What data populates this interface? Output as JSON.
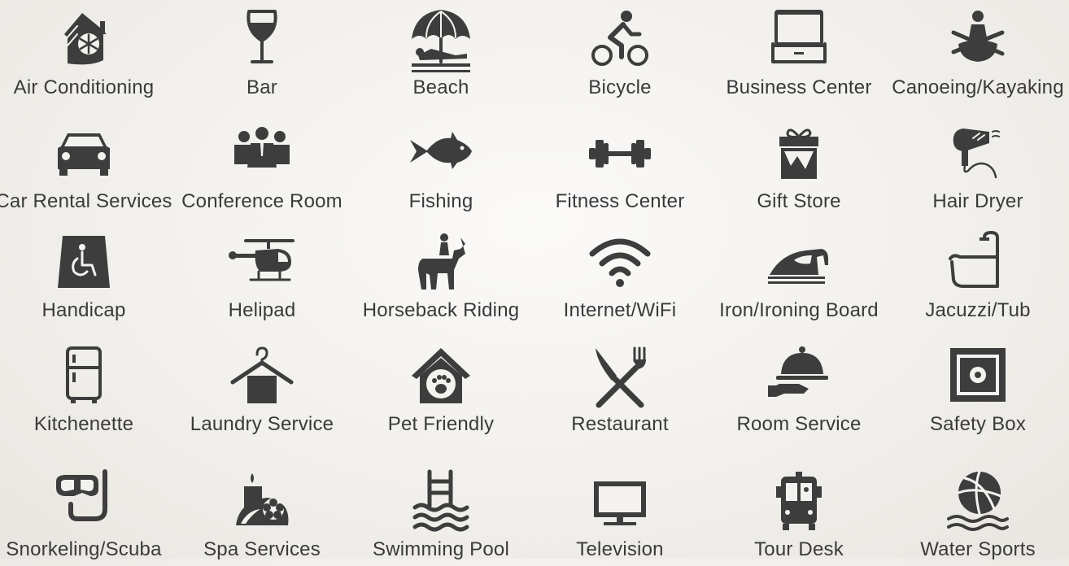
{
  "amenities": [
    {
      "label": "Air Conditioning",
      "icon": "air-conditioning-icon"
    },
    {
      "label": "Bar",
      "icon": "wine-glass-icon"
    },
    {
      "label": "Beach",
      "icon": "beach-umbrella-icon"
    },
    {
      "label": "Bicycle",
      "icon": "bicycle-icon"
    },
    {
      "label": "Business Center",
      "icon": "laptop-icon"
    },
    {
      "label": "Canoeing/Kayaking",
      "icon": "kayak-icon"
    },
    {
      "label": "Car Rental Services",
      "icon": "car-icon"
    },
    {
      "label": "Conference Room",
      "icon": "conference-people-icon"
    },
    {
      "label": "Fishing",
      "icon": "fish-icon"
    },
    {
      "label": "Fitness Center",
      "icon": "dumbbell-icon"
    },
    {
      "label": "Gift Store",
      "icon": "gift-icon"
    },
    {
      "label": "Hair Dryer",
      "icon": "hair-dryer-icon"
    },
    {
      "label": "Handicap",
      "icon": "wheelchair-icon"
    },
    {
      "label": "Helipad",
      "icon": "helicopter-icon"
    },
    {
      "label": "Horseback Riding",
      "icon": "horse-rider-icon"
    },
    {
      "label": "Internet/WiFi",
      "icon": "wifi-icon"
    },
    {
      "label": "Iron/Ironing Board",
      "icon": "iron-icon"
    },
    {
      "label": "Jacuzzi/Tub",
      "icon": "bathtub-icon"
    },
    {
      "label": "Kitchenette",
      "icon": "refrigerator-icon"
    },
    {
      "label": "Laundry Service",
      "icon": "hanger-icon"
    },
    {
      "label": "Pet Friendly",
      "icon": "pet-house-icon"
    },
    {
      "label": "Restaurant",
      "icon": "knife-fork-icon"
    },
    {
      "label": "Room Service",
      "icon": "cloche-icon"
    },
    {
      "label": "Safety Box",
      "icon": "safe-icon"
    },
    {
      "label": "Snorkeling/Scuba",
      "icon": "snorkel-mask-icon"
    },
    {
      "label": "Spa Services",
      "icon": "spa-candle-icon"
    },
    {
      "label": "Swimming Pool",
      "icon": "pool-ladder-icon"
    },
    {
      "label": "Television",
      "icon": "television-icon"
    },
    {
      "label": "Tour Desk",
      "icon": "bus-icon"
    },
    {
      "label": "Water Sports",
      "icon": "volleyball-icon"
    }
  ],
  "colors": {
    "ink": "#3d3d3d",
    "text": "#3a3a3a",
    "background": "#f4f2ee"
  }
}
